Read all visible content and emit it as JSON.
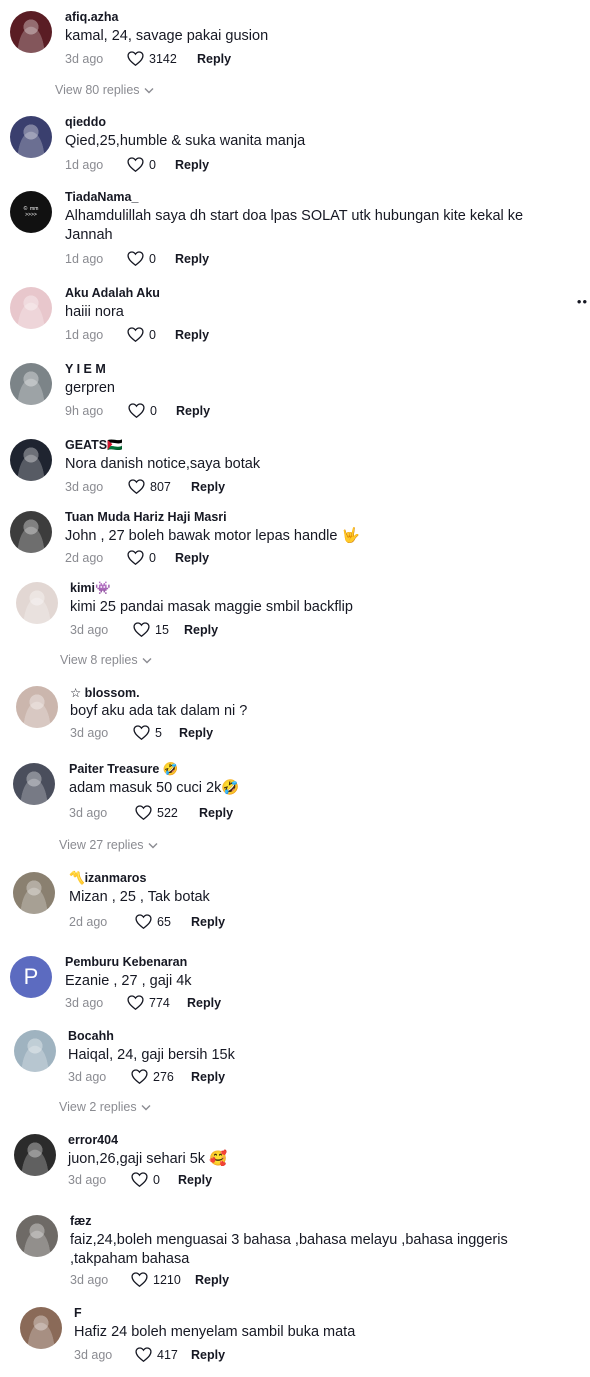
{
  "labels": {
    "reply": "Reply",
    "more": "••"
  },
  "comments": [
    {
      "user": "afiq.azha",
      "text": "kamal, 24, savage pakai gusion",
      "time": "3d ago",
      "likes": "3142",
      "avatar": "#5a1d24"
    },
    {
      "user": "qieddo",
      "text": "Qied,25,humble & suka wanita manja",
      "time": "1d ago",
      "likes": "0",
      "avatar": "#3a3f6e"
    },
    {
      "user": "TiadaNama_",
      "text": "Alhamdulillah saya dh start doa lpas SOLAT utk hubungan kite kekal ke Jannah",
      "time": "1d ago",
      "likes": "0",
      "avatar": "#111111",
      "avatar_text": "©  mm\n>>>>"
    },
    {
      "user": "Aku Adalah Aku",
      "text": "haiii nora",
      "time": "1d ago",
      "likes": "0",
      "avatar": "#e8c7cc"
    },
    {
      "user": "Y I E M",
      "text": "gerpren",
      "time": "9h ago",
      "likes": "0",
      "avatar": "#7c8488"
    },
    {
      "user": "GEATS🇵🇸",
      "text": "Nora danish notice,saya botak",
      "time": "3d ago",
      "likes": "807",
      "avatar": "#1f2430"
    },
    {
      "user": "Tuan Muda Hariz Haji Masri",
      "text": "John , 27 boleh bawak motor lepas handle 🤟",
      "time": "2d ago",
      "likes": "0",
      "avatar": "#3d3d3d"
    },
    {
      "user": "kimi👾",
      "text": "kimi 25 pandai masak maggie smbil backflip",
      "time": "3d ago",
      "likes": "15",
      "avatar": "#e2d7d3"
    },
    {
      "user": "☆ blossom.",
      "text": "boyf aku ada tak dalam ni ?",
      "time": "3d ago",
      "likes": "5",
      "avatar": "#cbb6ad"
    },
    {
      "user": "Paiter Treasure 🤣",
      "text": "adam masuk 50 cuci 2k🤣",
      "time": "3d ago",
      "likes": "522",
      "avatar": "#4a4e5c"
    },
    {
      "user": "〽️izanmaros",
      "text": "Mizan , 25 , Tak botak",
      "time": "2d ago",
      "likes": "65",
      "avatar": "#8a8070"
    },
    {
      "user": "Pemburu Kebenaran",
      "text": "Ezanie , 27 , gaji 4k",
      "time": "3d ago",
      "likes": "774",
      "avatar": "#5c6bc0",
      "avatar_text": "P"
    },
    {
      "user": "Bocahh",
      "text": "Haiqal, 24, gaji bersih 15k",
      "time": "3d ago",
      "likes": "276",
      "avatar": "#9fb3c0"
    },
    {
      "user": "error404",
      "text": "juon,26,gaji sehari 5k 🥰",
      "time": "3d ago",
      "likes": "0",
      "avatar": "#2b2b2b"
    },
    {
      "user": "fæz",
      "text": "faiz,24,boleh menguasai 3 bahasa ,bahasa melayu ,bahasa inggeris ,takpaham bahasa",
      "time": "3d ago",
      "likes": "1210",
      "avatar": "#6e6a66"
    },
    {
      "user": "F",
      "text": "Hafiz 24 boleh menyelam sambil buka mata",
      "time": "3d ago",
      "likes": "417",
      "avatar": "#8a6a58"
    }
  ],
  "view_replies": [
    "View 80 replies",
    "View 8 replies",
    "View 27 replies",
    "View 2 replies"
  ]
}
